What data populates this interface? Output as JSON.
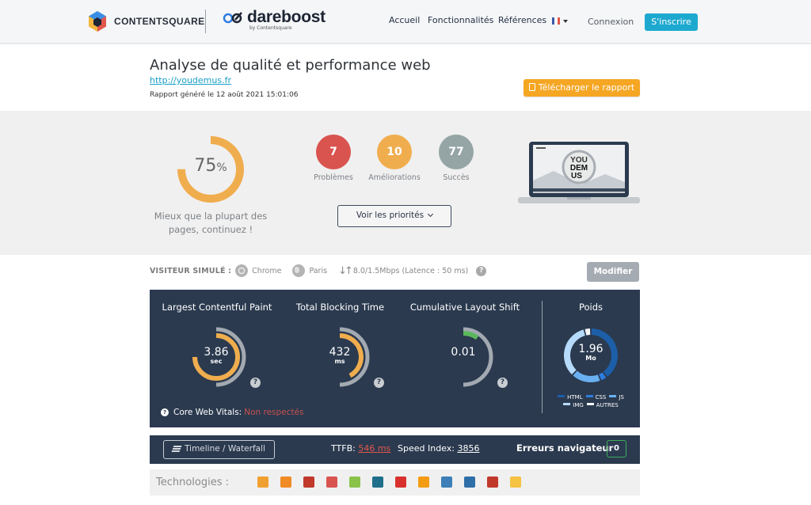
{
  "header": {
    "brand_contentsquare": "CONTENTSQUARE",
    "brand_dareboost": "dareboost",
    "brand_dareboost_sub": "by Contentsquare",
    "nav": [
      "Accueil",
      "Fonctionnalités",
      "Références"
    ],
    "language": "FR",
    "login": "Connexion",
    "signup": "S'inscrire",
    "colors": {
      "signup": "#1da9cf"
    }
  },
  "report": {
    "title": "Analyse de qualité et performance web",
    "url": "http://youdemus.fr",
    "generated": "Rapport généré le 12 août 2021 15:01:06",
    "download_label": "Télécharger le rapport"
  },
  "summary": {
    "score_value": "75",
    "score_unit": "%",
    "score_fraction": 0.75,
    "score_desc": "Mieux que la plupart des pages, continuez !",
    "counters": [
      {
        "value": "7",
        "label": "Problèmes",
        "color": "#d9534f"
      },
      {
        "value": "10",
        "label": "Améliorations",
        "color": "#f0ad4e"
      },
      {
        "value": "77",
        "label": "Succès",
        "color": "#95a5a6"
      }
    ],
    "priorities_label": "Voir les priorités",
    "screenshot_text": [
      "YOU",
      "DEM",
      "US"
    ]
  },
  "visitor": {
    "label": "VISITEUR SIMULÉ :",
    "browser": "Chrome",
    "location": "Paris",
    "connection": "8.0/1.5Mbps (Latence : 50 ms)",
    "help": "?",
    "modify_label": "Modifier"
  },
  "metrics": {
    "items": [
      {
        "title": "Largest Contentful Paint",
        "value": "3.86",
        "unit": "sec",
        "fraction": 0.75,
        "color": "#f0ad4e"
      },
      {
        "title": "Total Blocking Time",
        "value": "432",
        "unit": "ms",
        "fraction": 0.42,
        "color": "#f0ad4e"
      },
      {
        "title": "Cumulative Layout Shift",
        "value": "0.01",
        "unit": "",
        "fraction": 0.1,
        "color": "#5cb85c"
      }
    ],
    "weight": {
      "title": "Poids",
      "value": "1.96",
      "unit": "Mo",
      "segments": [
        {
          "name": "HTML",
          "share": 0.4,
          "color": "#1c5fa8"
        },
        {
          "name": "CSS",
          "share": 0.04,
          "color": "#2e7de0"
        },
        {
          "name": "JS",
          "share": 0.18,
          "color": "#6ab0f0"
        },
        {
          "name": "IMG",
          "share": 0.34,
          "color": "#b6dafa"
        },
        {
          "name": "AUTRES",
          "share": 0.04,
          "color": "#f4f6f8"
        }
      ]
    },
    "cwv_label": "Core Web Vitals:",
    "cwv_status": "Non respectés"
  },
  "bottom": {
    "timeline_label": "Timeline / Waterfall",
    "ttfb_label": "TTFB:",
    "ttfb_value": "546 ms",
    "speed_index_label": "Speed Index:",
    "speed_index_value": "3856",
    "errors_label": "Erreurs navigateur",
    "errors_value": "0"
  },
  "technologies": {
    "label": "Technologies :",
    "icons": [
      {
        "name": "tech-icon-1",
        "color": "#f0a030"
      },
      {
        "name": "analytics-icon",
        "color": "#f08a24"
      },
      {
        "name": "font-icon",
        "color": "#c0392b"
      },
      {
        "name": "tech-icon-4",
        "color": "#d9534f"
      },
      {
        "name": "tech-icon-5",
        "color": "#8bc34a"
      },
      {
        "name": "tech-icon-6",
        "color": "#1f6f8b"
      },
      {
        "name": "p-icon",
        "color": "#d9322e"
      },
      {
        "name": "tech-icon-8",
        "color": "#f39c12"
      },
      {
        "name": "wordpress-icon",
        "color": "#3d7fb6"
      },
      {
        "name": "jquery-icon",
        "color": "#2f6fa8"
      },
      {
        "name": "c-icon",
        "color": "#c0392b"
      },
      {
        "name": "shield-icon",
        "color": "#f5c242"
      }
    ]
  }
}
